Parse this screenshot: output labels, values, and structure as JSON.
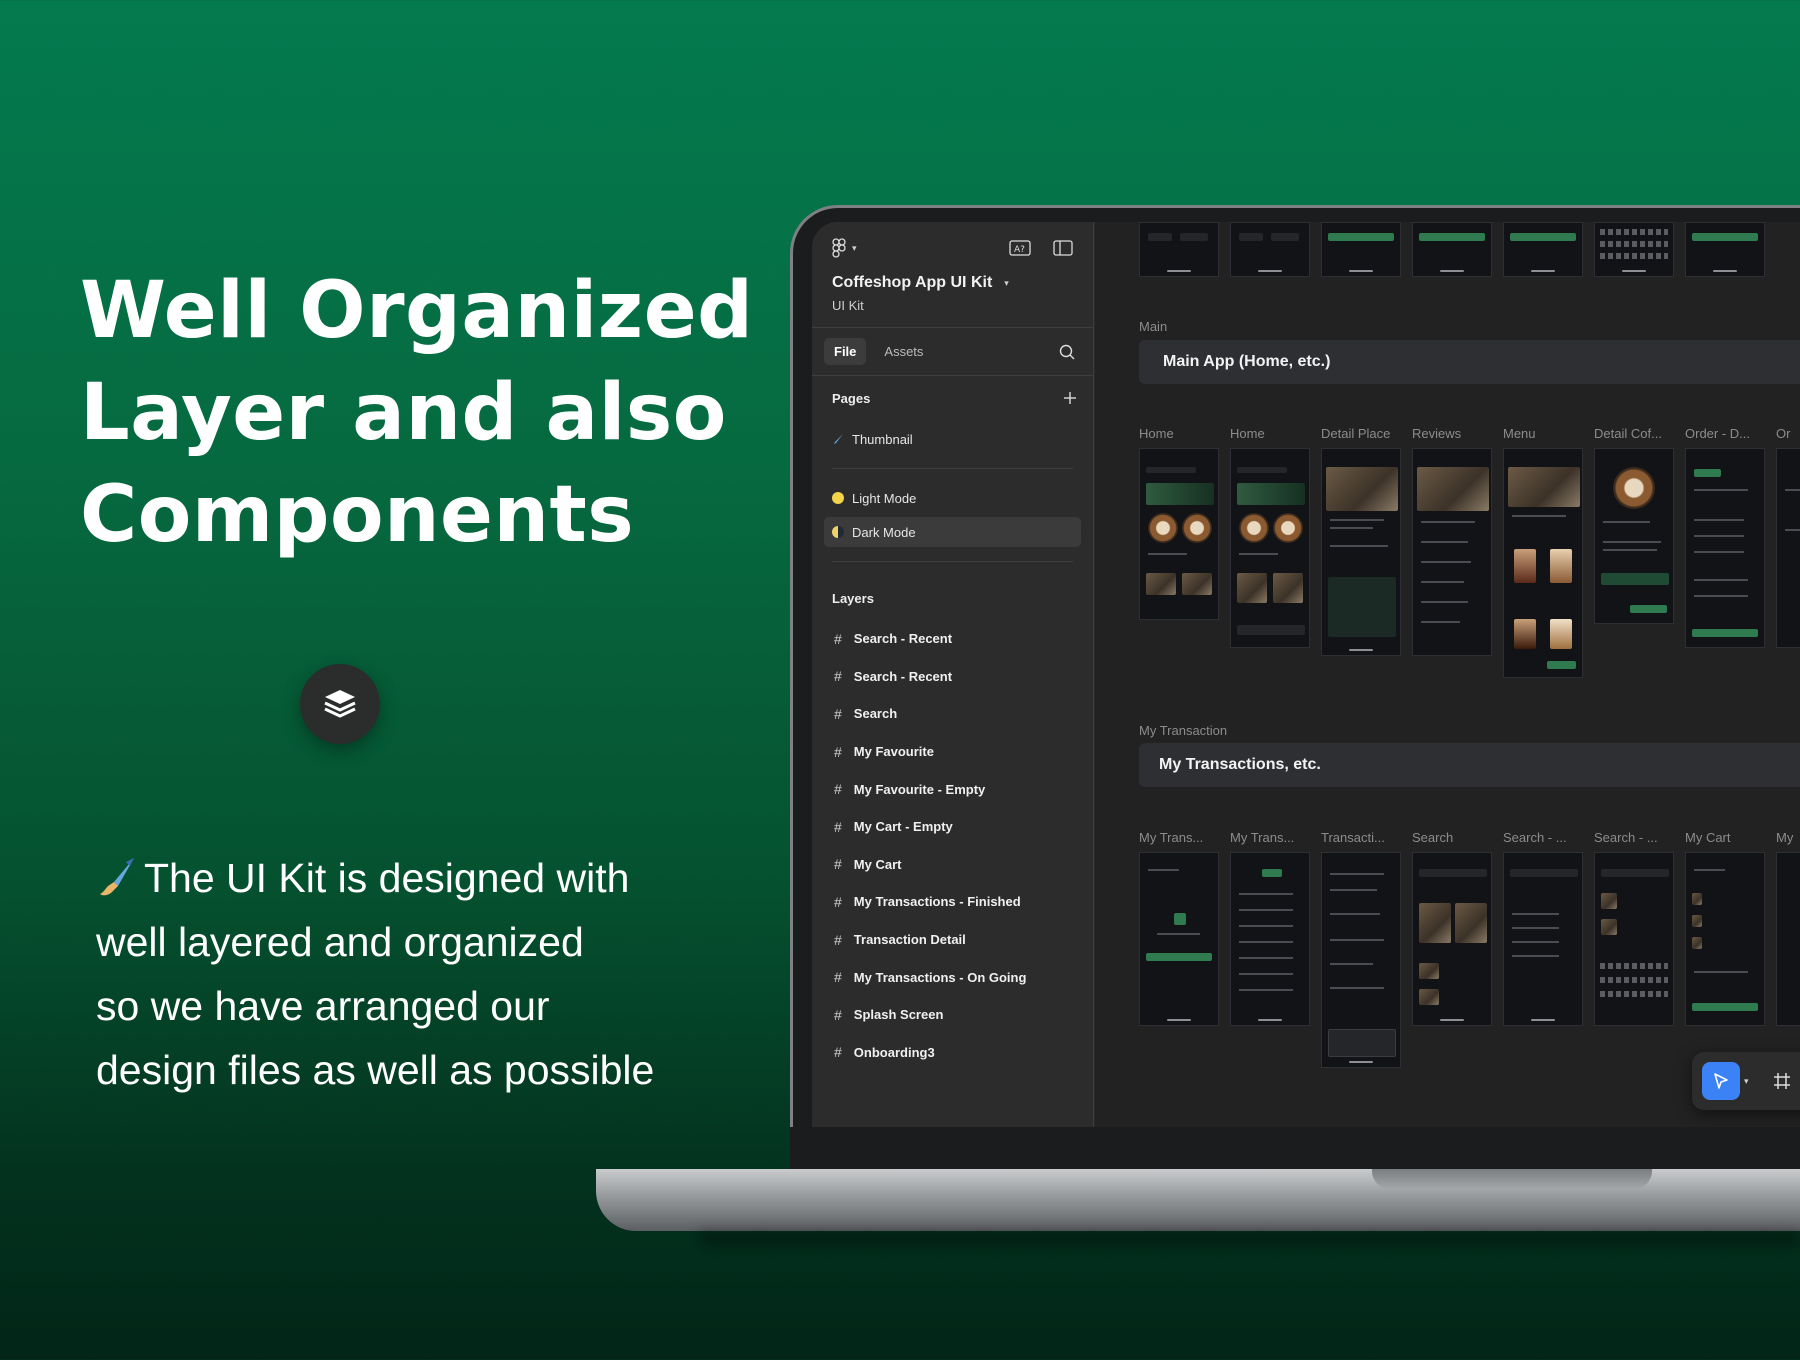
{
  "headline": [
    "Well Organized",
    "Layer and also",
    "Components"
  ],
  "body_lines": [
    "The UI Kit is designed with",
    "well layered and organized",
    "so we have arranged our",
    "design files as well as possible"
  ],
  "sidebar": {
    "file_title": "Coffeshop App UI Kit",
    "file_subtitle": "UI Kit",
    "tabs": [
      "File",
      "Assets"
    ],
    "pages_label": "Pages",
    "pages": [
      "Thumbnail",
      "Light Mode",
      "Dark Mode"
    ],
    "layers_label": "Layers",
    "layers": [
      "Search - Recent",
      "Search - Recent",
      "Search",
      "My Favourite",
      "My Favourite - Empty",
      "My Cart - Empty",
      "My Cart",
      "My Transactions - Finished",
      "Transaction Detail",
      "My Transactions - On Going",
      "Splash Screen",
      "Onboarding3"
    ]
  },
  "canvas": {
    "main_section_label": "Main",
    "main_banner": "Main App (Home, etc.)",
    "main_frames": [
      "Home",
      "Home",
      "Detail Place",
      "Reviews",
      "Menu",
      "Detail Cof...",
      "Order - D...",
      "Or"
    ],
    "transaction_section_label": "My Transaction",
    "transaction_banner": "My Transactions, etc.",
    "transaction_frames": [
      "My Trans...",
      "My Trans...",
      "Transacti...",
      "Search",
      "Search - ...",
      "Search - ...",
      "My Cart",
      "My"
    ]
  },
  "colors": {
    "brand_green": "#047a4f",
    "accent_blue": "#3b82f6",
    "panel": "#2c2c2c"
  }
}
